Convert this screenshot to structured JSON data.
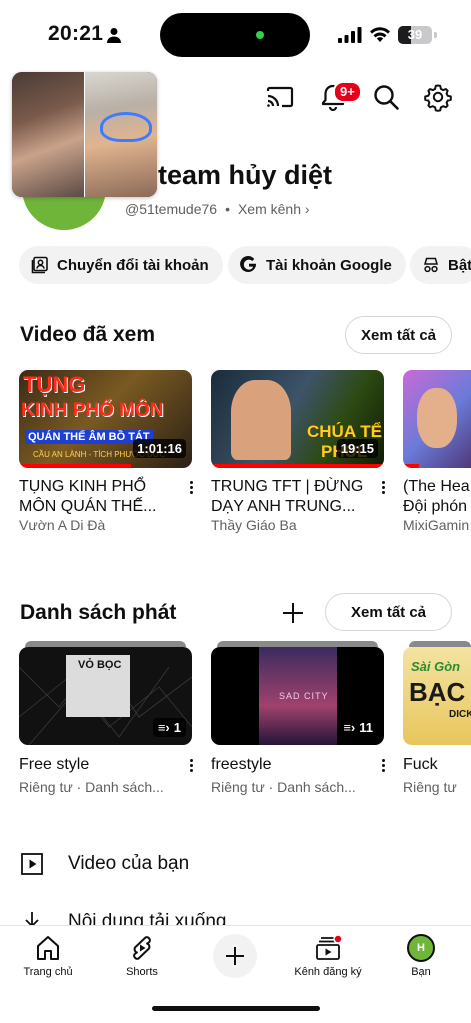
{
  "status_bar": {
    "time": "20:21",
    "battery": "39",
    "battery_level": 39
  },
  "header": {
    "notification_badge": "9+"
  },
  "profile": {
    "channel_name": "team hủy diệt",
    "handle": "@51temude76",
    "separator": "•",
    "view_channel": "Xem kênh",
    "avatar_letter": "H"
  },
  "chips": [
    {
      "label": "Chuyển đổi tài khoản",
      "icon": "switch-account-icon"
    },
    {
      "label": "Tài khoản Google",
      "icon": "google-icon"
    },
    {
      "label": "Bật",
      "icon": "incognito-icon"
    }
  ],
  "history": {
    "title": "Video đã xem",
    "see_all": "Xem tất cả",
    "videos": [
      {
        "title": "TỤNG KINH PHỔ MÔN QUÁN THẾ...",
        "channel": "Vườn A Di Đà",
        "duration": "1:01:16",
        "watched": 0.65,
        "thumb_text1": "TỤNG",
        "thumb_text2": "KINH PHỔ MÔN",
        "thumb_text3": "QUÁN THẾ ÂM BỒ TÁT",
        "thumb_text4": "CẦU AN LÀNH - TÍCH PHƯỚC ĐỨC"
      },
      {
        "title": "TRUNG TFT | ĐỪNG DẠY ANH TRUNG...",
        "channel": "Thầy Giáo Ba",
        "duration": "19:15",
        "watched": 1.0,
        "thumb_text1": "CHÚA TỂ",
        "thumb_text2": "PHUL"
      },
      {
        "title": "(The Hea Đội phón",
        "channel": "MixiGamin",
        "duration": "",
        "watched": 0.2
      }
    ]
  },
  "playlists": {
    "title": "Danh sách phát",
    "see_all": "Xem tất cả",
    "items": [
      {
        "title": "Free style",
        "meta": "Riêng tư · Danh sách...",
        "count": "1",
        "thumb_text": "VỎ BỌC"
      },
      {
        "title": "freestyle",
        "meta": "Riêng tư · Danh sách...",
        "count": "11",
        "thumb_text": "SAD CITY"
      },
      {
        "title": "Fuck",
        "meta": "Riêng tư",
        "count": "",
        "thumb_text1": "Sài Gòn",
        "thumb_text2": "BẠC",
        "thumb_text3": "DICK"
      }
    ]
  },
  "menu": [
    {
      "label": "Video của bạn",
      "icon": "play-box-icon"
    },
    {
      "label": "Nội dung tải xuống",
      "icon": "download-icon"
    }
  ],
  "bottom_nav": [
    {
      "label": "Trang chủ",
      "icon": "home-icon"
    },
    {
      "label": "Shorts",
      "icon": "shorts-icon"
    },
    {
      "label": "",
      "icon": "create-icon"
    },
    {
      "label": "Kênh đăng ký",
      "icon": "subscriptions-icon"
    },
    {
      "label": "Bạn",
      "icon": "you-avatar-icon"
    }
  ],
  "colors": {
    "accent_red": "#ff0000",
    "badge_red": "#e5001a",
    "text": "#0f0f0f",
    "secondary": "#606060",
    "avatar_green": "#6fb53a"
  }
}
